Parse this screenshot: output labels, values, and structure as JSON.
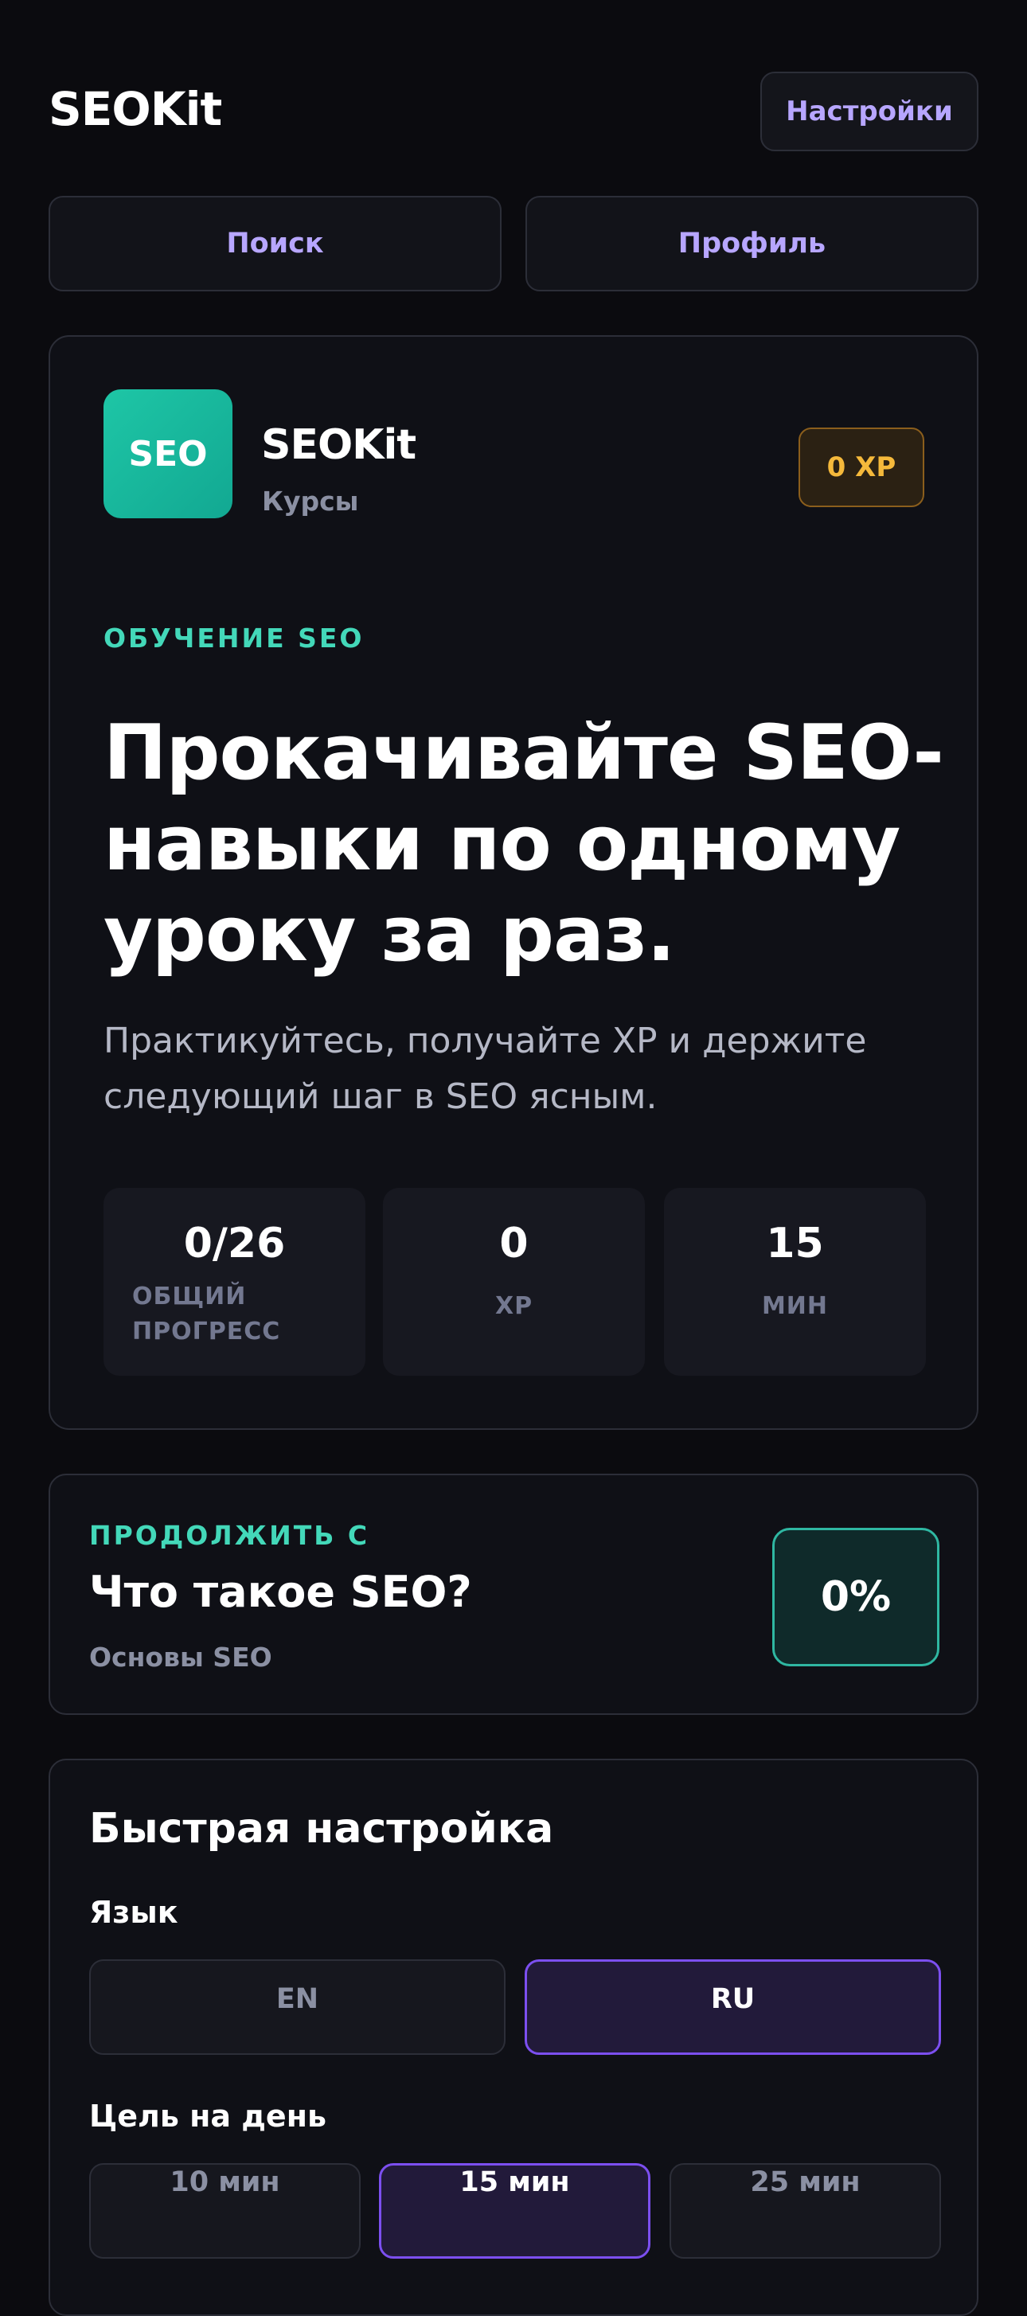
{
  "header": {
    "app_title": "SEOKit",
    "settings_label": "Настройки"
  },
  "nav": {
    "search_label": "Поиск",
    "profile_label": "Профиль"
  },
  "hero": {
    "logo_text": "SEO",
    "brand_name": "SEOKit",
    "brand_sub": "Курсы",
    "xp_badge": "0 XP",
    "eyebrow": "ОБУЧЕНИЕ SEO",
    "headline": "Прокачивайте SEO-навыки по одному уроку за раз.",
    "subtext": "Практикуйтесь, получайте XP и держите следующий шаг в SEO ясным.",
    "stats": [
      {
        "value": "0/26",
        "label": "ОБЩИЙ ПРОГРЕСС"
      },
      {
        "value": "0",
        "label": "XP"
      },
      {
        "value": "15",
        "label": "МИН"
      }
    ]
  },
  "continue": {
    "eyebrow": "ПРОДОЛЖИТЬ С",
    "title": "Что такое SEO?",
    "subtitle": "Основы SEO",
    "progress": "0%"
  },
  "setup": {
    "title": "Быстрая настройка",
    "language_label": "Язык",
    "languages": [
      {
        "label": "EN",
        "selected": false
      },
      {
        "label": "RU",
        "selected": true
      }
    ],
    "goal_label": "Цель на день",
    "goals": [
      {
        "label": "10 мин",
        "selected": false
      },
      {
        "label": "15 мин",
        "selected": true
      },
      {
        "label": "25 мин",
        "selected": false
      }
    ]
  },
  "colors": {
    "background": "#0b0b0f",
    "card": "#0f1016",
    "accent_purple": "#b7a6ff",
    "accent_teal": "#43d8b9",
    "xp_gold": "#f5b93b",
    "selected_border": "#7c4ff0"
  }
}
